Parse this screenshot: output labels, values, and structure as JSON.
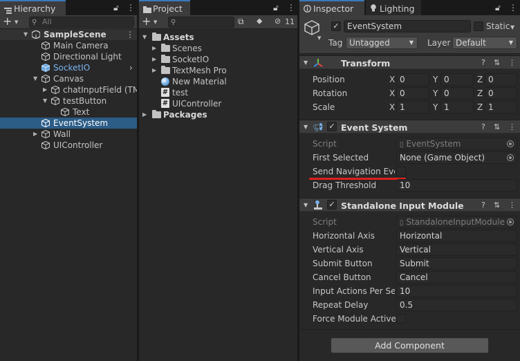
{
  "hierarchy": {
    "tab": "Hierarchy",
    "search_placeholder": "All",
    "scene": "SampleScene",
    "items": [
      {
        "label": "Main Camera"
      },
      {
        "label": "Directional Light"
      },
      {
        "label": "SocketIO"
      },
      {
        "label": "Canvas"
      },
      {
        "label": "chatInputField (TM"
      },
      {
        "label": "testButton"
      },
      {
        "label": "Text"
      },
      {
        "label": "EventSystem"
      },
      {
        "label": "Wall"
      },
      {
        "label": "UIController"
      }
    ]
  },
  "project": {
    "tab": "Project",
    "hidden_count": "11",
    "items": [
      {
        "label": "Assets"
      },
      {
        "label": "Scenes"
      },
      {
        "label": "SocketIO"
      },
      {
        "label": "TextMesh Pro"
      },
      {
        "label": "New Material"
      },
      {
        "label": "test"
      },
      {
        "label": "UIController"
      },
      {
        "label": "Packages"
      }
    ]
  },
  "inspector": {
    "tabs": [
      {
        "label": "Inspector"
      },
      {
        "label": "Lighting"
      }
    ],
    "object_name": "EventSystem",
    "static_label": "Static",
    "tag_label": "Tag",
    "tag_value": "Untagged",
    "layer_label": "Layer",
    "layer_value": "Default",
    "transform": {
      "title": "Transform",
      "position_label": "Position",
      "rotation_label": "Rotation",
      "scale_label": "Scale",
      "axis_x": "X",
      "axis_y": "Y",
      "axis_z": "Z",
      "position": [
        "0",
        "0",
        "0"
      ],
      "rotation": [
        "0",
        "0",
        "0"
      ],
      "scale": [
        "1",
        "1",
        "1"
      ]
    },
    "event_system": {
      "title": "Event System",
      "script_label": "Script",
      "script_value": "EventSystem",
      "first_selected_label": "First Selected",
      "first_selected_value": "None (Game Object)",
      "send_nav_label": "Send Navigation Events",
      "drag_threshold_label": "Drag Threshold",
      "drag_threshold_value": "10"
    },
    "standalone": {
      "title": "Standalone Input Module",
      "script_label": "Script",
      "script_value": "StandaloneInputModule",
      "horizontal_axis_label": "Horizontal Axis",
      "horizontal_axis_value": "Horizontal",
      "vertical_axis_label": "Vertical Axis",
      "vertical_axis_value": "Vertical",
      "submit_label": "Submit Button",
      "submit_value": "Submit",
      "cancel_label": "Cancel Button",
      "cancel_value": "Cancel",
      "input_actions_label": "Input Actions Per Second",
      "input_actions_value": "10",
      "repeat_delay_label": "Repeat Delay",
      "repeat_delay_value": "0.5",
      "force_module_label": "Force Module Active"
    },
    "add_component": "Add Component"
  },
  "colors": {
    "selection": "#2c5d87",
    "link_blue": "#7ab3ef",
    "annotation_red": "#e0201a"
  }
}
